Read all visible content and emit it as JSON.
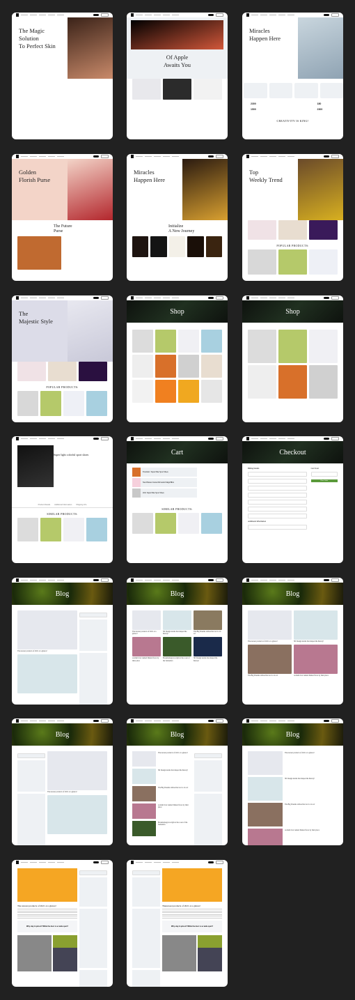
{
  "colors": {
    "background": "#212121",
    "card": "#ffffff",
    "accent_blog_badge": "#e8654a",
    "checkout_button": "#5a9a3a"
  },
  "cards": [
    {
      "kind": "hero",
      "title": [
        "The Magic",
        "Solution",
        "To Perfect Skin"
      ],
      "hero_bg": "#ffffff",
      "hero_img": [
        "#3a2218",
        "#c98a6a"
      ],
      "tiles": [
        "#ffffff"
      ],
      "tile_cols": 1,
      "heading": ""
    },
    {
      "kind": "hero",
      "title": [
        "Of Apple",
        "Awaits You"
      ],
      "hero_bg": "#eef1f4",
      "hero_img": [
        "#000000",
        "#d2573a"
      ],
      "wide_img": true,
      "tiles": [
        "#e8e8ec",
        "#2b2b2b",
        "#f2f2f2"
      ],
      "tile_cols": 3,
      "heading": ""
    },
    {
      "kind": "hero",
      "title": [
        "Miracles",
        "Happen Here"
      ],
      "hero_bg": "#ffffff",
      "hero_img": [
        "#c9d6de",
        "#8fa3b3"
      ],
      "features": true,
      "stats": [
        "2300",
        "180",
        "1500",
        "2300"
      ],
      "heading": "CREATIVITY IS KING!"
    },
    {
      "kind": "hero",
      "title": [
        "Golden",
        "Florish Purse"
      ],
      "hero_bg": "#f3d4c8",
      "hero_img": [
        "#f3d4c8",
        "#b3262c"
      ],
      "second_title": [
        "The Future",
        "Purse"
      ],
      "tiles": [
        "#c06a30"
      ],
      "tile_cols": 2,
      "heading": ""
    },
    {
      "kind": "hero",
      "title": [
        "Miracles",
        "Happen Here"
      ],
      "hero_bg": "#ffffff",
      "hero_img": [
        "#2a1a10",
        "#d9a030"
      ],
      "second_title": [
        "Initialize",
        "A New Journey"
      ],
      "tiles": [
        "#1e1410",
        "#141414",
        "#f3f0e8",
        "#1a0f08",
        "#3a2410"
      ],
      "tile_cols": 5,
      "heading": ""
    },
    {
      "kind": "hero",
      "title": [
        "Top",
        "Weekly Trend"
      ],
      "hero_bg": "#ffffff",
      "hero_img": [
        "#6a4a2a",
        "#d8b020"
      ],
      "tiles": [
        "#f0e2e6",
        "#e8ddd0",
        "#3a1a5a"
      ],
      "tile_cols": 3,
      "heading": "POPULAR PRODUCTS:",
      "tiles2": [
        "#d8d8d8",
        "#b5c96a",
        "#eef0f6"
      ]
    },
    {
      "kind": "hero",
      "title": [
        "The",
        "Majestic Style"
      ],
      "hero_bg": "#dcdce8",
      "hero_img": [
        "#e8e8f0",
        "#c8c8d8"
      ],
      "tiles": [
        "#f0e2e6",
        "#e8ddd0",
        "#2a1040"
      ],
      "tile_cols": 3,
      "heading": "POPULAR PRODUCTS:",
      "tiles2": [
        "#d8d8d8",
        "#b5c96a",
        "#eef0f6",
        "#a8d0e0"
      ]
    },
    {
      "kind": "banner",
      "title": "Shop",
      "banner_bg": [
        "#0e120e",
        "#203020"
      ],
      "tiles": [
        "#dcdcdc",
        "#b5c96a",
        "#f0f0f4",
        "#a8d0e0",
        "#eeeeee",
        "#d8702a",
        "#d0d0d0",
        "#e8ddd0",
        "#f2f2f2",
        "#f08020",
        "#f0a820",
        "#e6e6e6"
      ],
      "tile_cols": 4,
      "heading": ""
    },
    {
      "kind": "banner",
      "title": "Shop",
      "banner_bg": [
        "#0e120e",
        "#203020"
      ],
      "tiles": [
        "#dcdcdc",
        "#b5c96a",
        "#f0f0f4",
        "#eeeeee",
        "#d8702a",
        "#d0d0d0"
      ],
      "tile_cols": 3,
      "tall": true,
      "heading": ""
    },
    {
      "kind": "hero",
      "title": [
        "Super light colorful sport shoes"
      ],
      "small_title": true,
      "hero_bg": "#ffffff",
      "hero_img": [
        "#111111",
        "#333333"
      ],
      "img_left": true,
      "tiles": [
        "#dcdcdc",
        "#b5c96a",
        "#f0f0f4",
        "#a8d0e0"
      ],
      "tile_cols": 4,
      "heading": "SIMILAR PRODUCTS:",
      "tabs": [
        "Product Details",
        "Additional Information",
        "Shipping Info"
      ]
    },
    {
      "kind": "banner",
      "title": "Cart",
      "banner_bg": [
        "#0e120e",
        "#203020"
      ],
      "rows": [
        "Excellent / Super Nike Sport Shoes",
        "New Balance Series 840 Ardelt MagicBlitz",
        "2021 Super Nike Sport Shoes"
      ],
      "tiles": [
        "#dcdcdc",
        "#b5c96a",
        "#f0f0f4",
        "#a8d0e0"
      ],
      "tile_cols": 4,
      "heading": "SIMILAR PRODUCTS:"
    },
    {
      "kind": "checkout",
      "title": "Checkout",
      "banner_bg": [
        "#0e120e",
        "#203020"
      ],
      "labels": [
        "Billing Details",
        "Cart Total",
        "Additional Information",
        "Place Order"
      ]
    },
    {
      "kind": "blog",
      "title": "Blog",
      "tiles": [
        "#e6e8ee",
        "#d8e6ea"
      ],
      "tile_cols": 1,
      "sidebar": true,
      "posts": [
        "The newest products of 2021 at a glance!",
        ""
      ]
    },
    {
      "kind": "blog",
      "title": "Blog",
      "tiles": [
        "#e6e8ee",
        "#d8e6ea",
        "#8a7a60",
        "#b87890",
        "#3a5a2a",
        "#1a2a4a"
      ],
      "tile_cols": 3,
      "posts": [
        "The newest products of 2021 at a glance!",
        "3D Design trends that shaped the history!",
        "The Big Dreams advised her not to do so!",
        "A small river named Duden flows by their place",
        "Bookmarksgrove right at the coast of the Semantics",
        "3D Design trends that shaped the history!"
      ]
    },
    {
      "kind": "blog",
      "title": "Blog",
      "tiles": [
        "#e6e8ee",
        "#d8e6ea",
        "#8a7060",
        "#b87890"
      ],
      "tile_cols": 2,
      "posts": [
        "The newest products of 2021 at a glance!",
        "3D Design trends that shaped the history!",
        "The Big Dreams advised her not to do so!",
        "A small river named Duden flows by their place"
      ]
    },
    {
      "kind": "blog",
      "title": "Blog",
      "tiles": [
        "#e6e8ee",
        "#d8e6ea"
      ],
      "tile_cols": 1,
      "sidebar": true,
      "sidebar_left": true,
      "posts": [
        "The newest products of 2021 at a glance!",
        ""
      ]
    },
    {
      "kind": "blog",
      "title": "Blog",
      "tiles": [
        "#e6e8ee",
        "#d8e6ea",
        "#8a7060",
        "#b87890",
        "#3a5a2a"
      ],
      "tile_cols": 1,
      "list": true,
      "sidebar": true,
      "posts": [
        "The newest products of 2021 at a glance!",
        "3D Design trends that shaped the history!",
        "The Big Dreams advised her not to do so!",
        "A small river named Duden flows by their place",
        "Bookmarksgrove right at the coast of the Semantics"
      ]
    },
    {
      "kind": "blog",
      "title": "Blog",
      "tiles": [
        "#e6e8ee",
        "#d8e6ea",
        "#8a7060",
        "#b87890"
      ],
      "tile_cols": 1,
      "list": true,
      "posts": [
        "The newest products of 2021 at a glance!",
        "3D Design trends that shaped the history!",
        "The Big Dreams advised her not to do so!",
        "A small river named Duden flows by their place"
      ]
    },
    {
      "kind": "post",
      "title": "The newest products of 2021 at a glance!",
      "quote": "Why stay in prison? While the door is so wide open?",
      "img": "#f5a623",
      "sidebar_left": false
    },
    {
      "kind": "post",
      "title": "Thenewest products of 2021 at a glance!",
      "quote": "Why stay in prison? While the door is so wide open?",
      "img": "#f5a623",
      "sidebar_left": true
    }
  ]
}
